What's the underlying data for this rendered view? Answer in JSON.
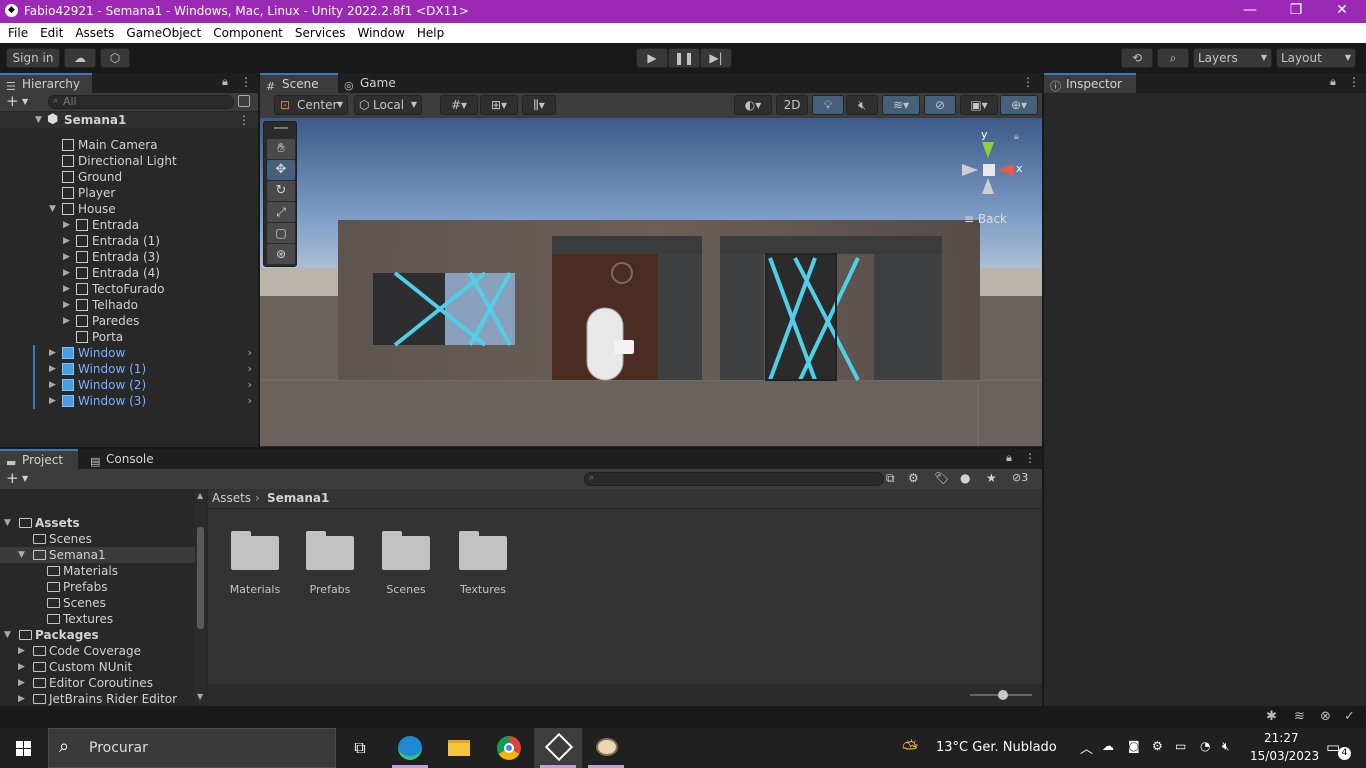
{
  "window": {
    "title": "Fabio42921 - Semana1 - Windows, Mac, Linux - Unity 2022.2.8f1 <DX11>",
    "minimize": "—",
    "restore": "❐",
    "close": "✕"
  },
  "menu": [
    "File",
    "Edit",
    "Assets",
    "GameObject",
    "Component",
    "Services",
    "Window",
    "Help"
  ],
  "toolbar": {
    "sign_in": "Sign in",
    "layers": "Layers",
    "layout": "Layout"
  },
  "hierarchy": {
    "tab": "Hierarchy",
    "search_placeholder": "All",
    "scene": "Semana1",
    "items": [
      {
        "label": "Main Camera",
        "depth": 1,
        "arrow": "",
        "blue": false
      },
      {
        "label": "Directional Light",
        "depth": 1,
        "arrow": "",
        "blue": false
      },
      {
        "label": "Ground",
        "depth": 1,
        "arrow": "",
        "blue": false
      },
      {
        "label": "Player",
        "depth": 1,
        "arrow": "",
        "blue": false
      },
      {
        "label": "House",
        "depth": 1,
        "arrow": "▼",
        "blue": false
      },
      {
        "label": "Entrada",
        "depth": 2,
        "arrow": "▶",
        "blue": false
      },
      {
        "label": "Entrada (1)",
        "depth": 2,
        "arrow": "▶",
        "blue": false
      },
      {
        "label": "Entrada (3)",
        "depth": 2,
        "arrow": "▶",
        "blue": false
      },
      {
        "label": "Entrada (4)",
        "depth": 2,
        "arrow": "▶",
        "blue": false
      },
      {
        "label": "TectoFurado",
        "depth": 2,
        "arrow": "▶",
        "blue": false
      },
      {
        "label": "Telhado",
        "depth": 2,
        "arrow": "▶",
        "blue": false
      },
      {
        "label": "Paredes",
        "depth": 2,
        "arrow": "▶",
        "blue": false
      },
      {
        "label": "Porta",
        "depth": 2,
        "arrow": "",
        "blue": false
      },
      {
        "label": "Window",
        "depth": 1,
        "arrow": "▶",
        "blue": true
      },
      {
        "label": "Window (1)",
        "depth": 1,
        "arrow": "▶",
        "blue": true
      },
      {
        "label": "Window (2)",
        "depth": 1,
        "arrow": "▶",
        "blue": true
      },
      {
        "label": "Window (3)",
        "depth": 1,
        "arrow": "▶",
        "blue": true
      }
    ]
  },
  "scene_view": {
    "tab_scene": "Scene",
    "tab_game": "Game",
    "pivot": "Center",
    "space": "Local",
    "mode_2d": "2D",
    "gizmo_y": "y",
    "gizmo_x": "x",
    "gizmo_back": "Back"
  },
  "inspector": {
    "tab": "Inspector"
  },
  "project": {
    "tab_project": "Project",
    "tab_console": "Console",
    "hidden_count": "3",
    "breadcrumb_root": "Assets",
    "breadcrumb_current": "Semana1",
    "tree": [
      {
        "label": "Assets",
        "depth": 0,
        "arrow": "▼",
        "bold": true,
        "selected": false
      },
      {
        "label": "Scenes",
        "depth": 1,
        "arrow": "",
        "bold": false,
        "selected": false
      },
      {
        "label": "Semana1",
        "depth": 1,
        "arrow": "▼",
        "bold": false,
        "selected": true
      },
      {
        "label": "Materials",
        "depth": 2,
        "arrow": "",
        "bold": false,
        "selected": false
      },
      {
        "label": "Prefabs",
        "depth": 2,
        "arrow": "",
        "bold": false,
        "selected": false
      },
      {
        "label": "Scenes",
        "depth": 2,
        "arrow": "",
        "bold": false,
        "selected": false
      },
      {
        "label": "Textures",
        "depth": 2,
        "arrow": "",
        "bold": false,
        "selected": false
      },
      {
        "label": "Packages",
        "depth": 0,
        "arrow": "▼",
        "bold": true,
        "selected": false
      },
      {
        "label": "Code Coverage",
        "depth": 1,
        "arrow": "▶",
        "bold": false,
        "selected": false
      },
      {
        "label": "Custom NUnit",
        "depth": 1,
        "arrow": "▶",
        "bold": false,
        "selected": false
      },
      {
        "label": "Editor Coroutines",
        "depth": 1,
        "arrow": "▶",
        "bold": false,
        "selected": false
      },
      {
        "label": "JetBrains Rider Editor",
        "depth": 1,
        "arrow": "▶",
        "bold": false,
        "selected": false
      }
    ],
    "folders": [
      "Materials",
      "Prefabs",
      "Scenes",
      "Textures"
    ]
  },
  "taskbar": {
    "search_placeholder": "Procurar",
    "weather": "13°C  Ger. Nublado",
    "time": "21:27",
    "date": "15/03/2023",
    "notifications": "4"
  },
  "colors": {
    "titlebar": "#9b29b3",
    "accent": "#3a79bb",
    "prefab_blue": "#7bafff"
  }
}
